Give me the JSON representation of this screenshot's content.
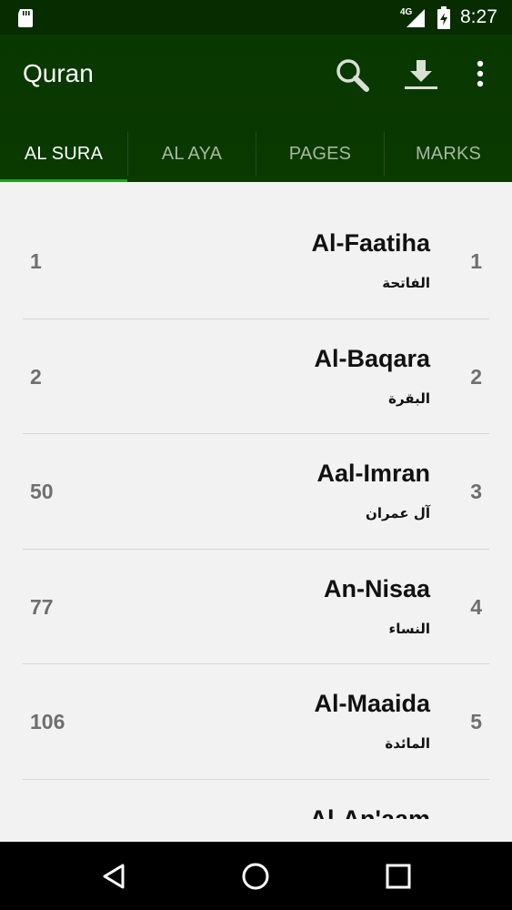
{
  "status_bar": {
    "network": "4G",
    "time": "8:27",
    "icons": [
      "sd-card-icon",
      "signal-icon",
      "battery-charging-icon"
    ]
  },
  "app_bar": {
    "title": "Quran",
    "actions": [
      "search-icon",
      "download-icon",
      "overflow-menu-icon"
    ]
  },
  "tabs": [
    {
      "label": "AL SURA",
      "active": true
    },
    {
      "label": "AL AYA",
      "active": false
    },
    {
      "label": "PAGES",
      "active": false
    },
    {
      "label": "MARKS",
      "active": false
    }
  ],
  "suras": [
    {
      "ayat": "1",
      "name": "Al-Faatiha",
      "arabic": "الفاتحة",
      "number": "1"
    },
    {
      "ayat": "2",
      "name": "Al-Baqara",
      "arabic": "البقرة",
      "number": "2"
    },
    {
      "ayat": "50",
      "name": "Aal-Imran",
      "arabic": "آل عمران",
      "number": "3"
    },
    {
      "ayat": "77",
      "name": "An-Nisaa",
      "arabic": "النساء",
      "number": "4"
    },
    {
      "ayat": "106",
      "name": "Al-Maaida",
      "arabic": "المائدة",
      "number": "5"
    },
    {
      "ayat": "",
      "name": "Al-An'aam",
      "arabic": "",
      "number": ""
    }
  ],
  "nav_bar": [
    "back-icon",
    "home-icon",
    "recents-icon"
  ],
  "colors": {
    "app_bar": "#093700",
    "status_bar": "#062c00",
    "tab_indicator": "#1fa214",
    "background": "#f2f2f2"
  }
}
